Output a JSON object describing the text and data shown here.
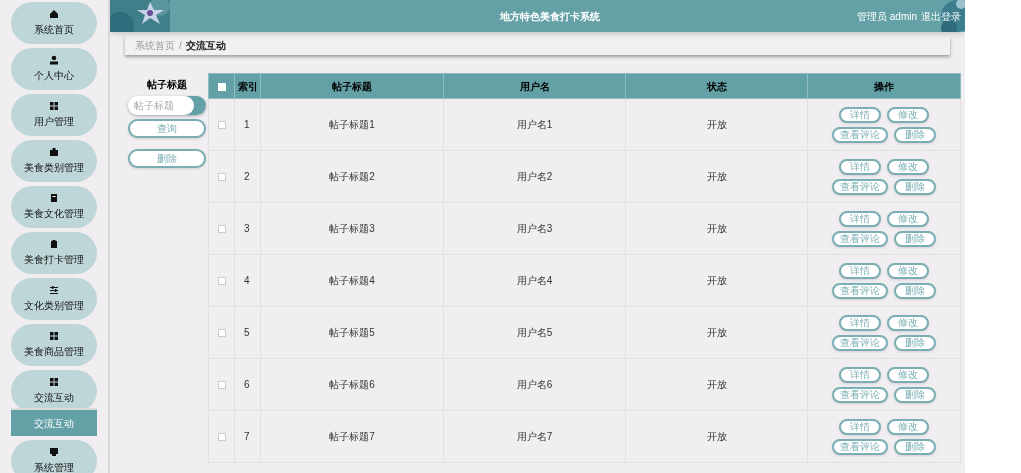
{
  "sidebar": {
    "items": [
      {
        "label": "系统首页"
      },
      {
        "label": "个人中心"
      },
      {
        "label": "用户管理"
      },
      {
        "label": "美食类别管理"
      },
      {
        "label": "美食文化管理"
      },
      {
        "label": "美食打卡管理"
      },
      {
        "label": "文化类别管理"
      },
      {
        "label": "美食商品管理"
      },
      {
        "label": "交流互动",
        "expanded": true,
        "children": [
          {
            "label": "交流互动",
            "selected": true
          }
        ]
      },
      {
        "label": "系统管理"
      }
    ]
  },
  "header": {
    "title": "地方特色美食打卡系统",
    "user": "管理员 admin",
    "logout": "退出登录"
  },
  "breadcrumb": [
    "系统首页",
    "/",
    "交流互动"
  ],
  "search": {
    "label": "帖子标题",
    "placeholder": "帖子标题",
    "buttons": [
      "查询",
      "删除"
    ]
  },
  "table": {
    "select_all_checked": false,
    "columns": [
      "索引",
      "帖子标题",
      "用户名",
      "状态",
      "操作"
    ],
    "rows": [
      {
        "checked": false,
        "cells": [
          "1",
          "帖子标题1",
          "用户名1",
          "开放"
        ],
        "actions": [
          "详情",
          "修改",
          "查看评论",
          "删除"
        ]
      },
      {
        "checked": false,
        "cells": [
          "2",
          "帖子标题2",
          "用户名2",
          "开放"
        ],
        "actions": [
          "详情",
          "修改",
          "查看评论",
          "删除"
        ]
      },
      {
        "checked": false,
        "cells": [
          "3",
          "帖子标题3",
          "用户名3",
          "开放"
        ],
        "actions": [
          "详情",
          "修改",
          "查看评论",
          "删除"
        ]
      },
      {
        "checked": false,
        "cells": [
          "4",
          "帖子标题4",
          "用户名4",
          "开放"
        ],
        "actions": [
          "详情",
          "修改",
          "查看评论",
          "删除"
        ]
      },
      {
        "checked": false,
        "cells": [
          "5",
          "帖子标题5",
          "用户名5",
          "开放"
        ],
        "actions": [
          "详情",
          "修改",
          "查看评论",
          "删除"
        ]
      },
      {
        "checked": false,
        "cells": [
          "6",
          "帖子标题6",
          "用户名6",
          "开放"
        ],
        "actions": [
          "详情",
          "修改",
          "查看评论",
          "删除"
        ]
      },
      {
        "checked": false,
        "cells": [
          "7",
          "帖子标题7",
          "用户名7",
          "开放"
        ],
        "actions": [
          "详情",
          "修改",
          "查看评论",
          "删除"
        ]
      }
    ]
  }
}
